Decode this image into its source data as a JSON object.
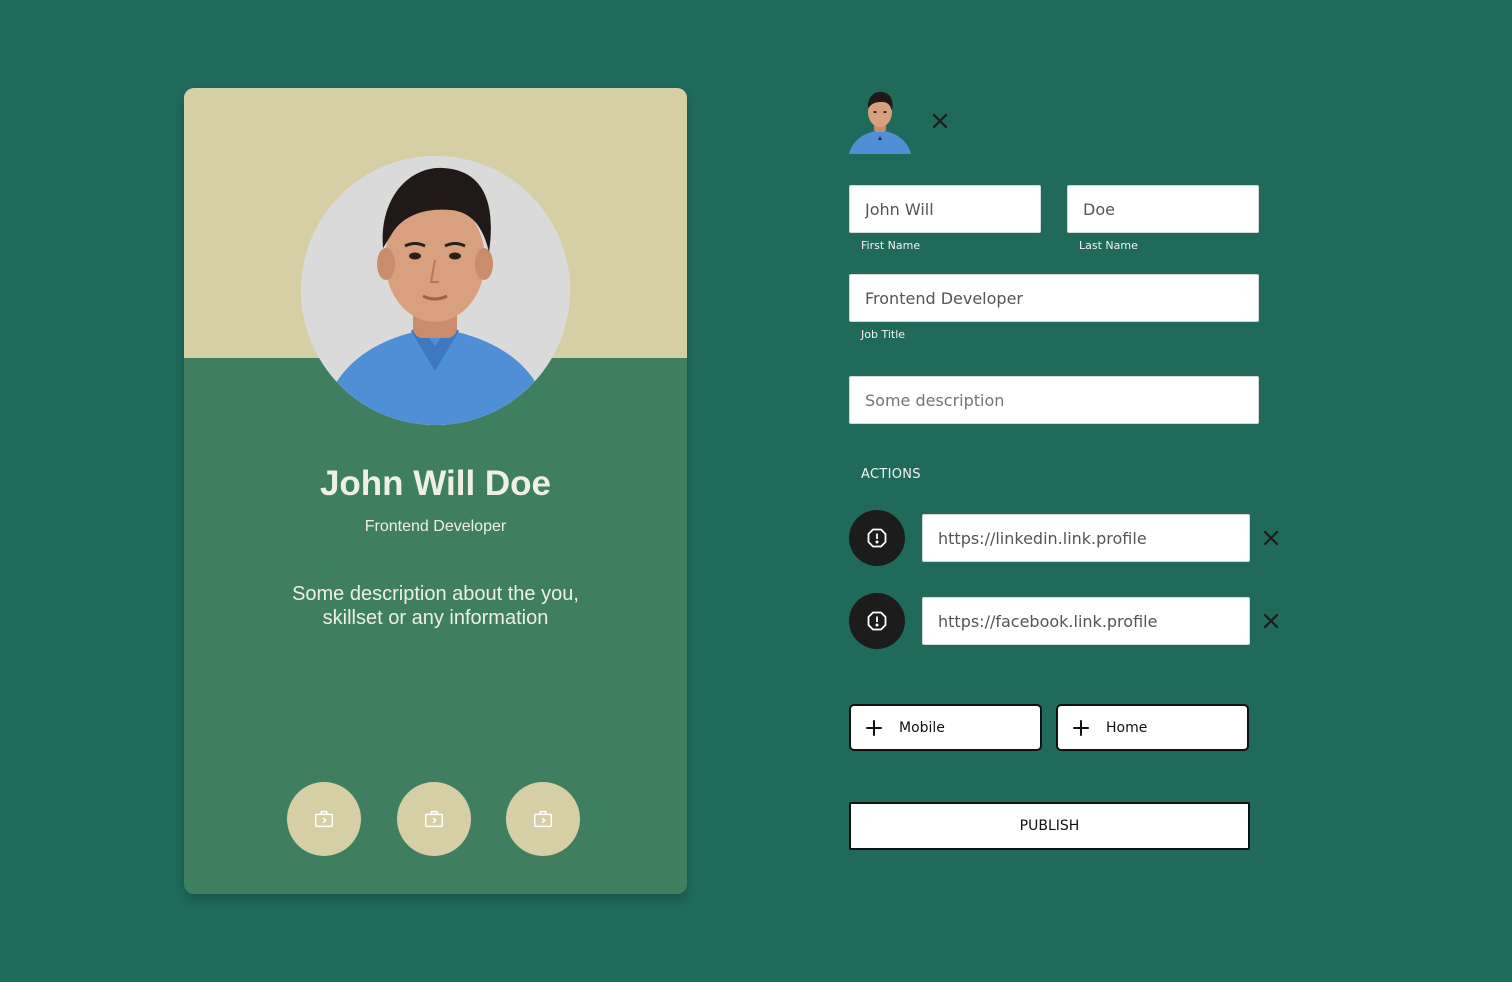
{
  "card": {
    "name": "John Will Doe",
    "job_title": "Frontend Developer",
    "description": "Some description about the you, skillset or any information",
    "actions": [
      {
        "icon": "briefcase-icon"
      },
      {
        "icon": "briefcase-icon"
      },
      {
        "icon": "briefcase-icon"
      }
    ]
  },
  "editor": {
    "first_name": {
      "value": "John Will",
      "label": "First Name"
    },
    "last_name": {
      "value": "Doe",
      "label": "Last Name"
    },
    "job_title": {
      "value": "Frontend Developer",
      "label": "Job Title"
    },
    "description": {
      "placeholder": "Some description"
    },
    "actions_label": "ACTIONS",
    "links": [
      {
        "value": "https://linkedin.link.profile",
        "icon": "alert-icon"
      },
      {
        "value": "https://facebook.link.profile",
        "icon": "alert-icon"
      }
    ],
    "add_buttons": [
      {
        "label": "Mobile"
      },
      {
        "label": "Home"
      }
    ],
    "publish_label": "PUBLISH"
  },
  "colors": {
    "background": "#1f6a5a",
    "card_body": "#3f7f60",
    "card_header": "#d6cfa6",
    "text_light": "#eef0e2",
    "dark": "#1c1c1c"
  }
}
